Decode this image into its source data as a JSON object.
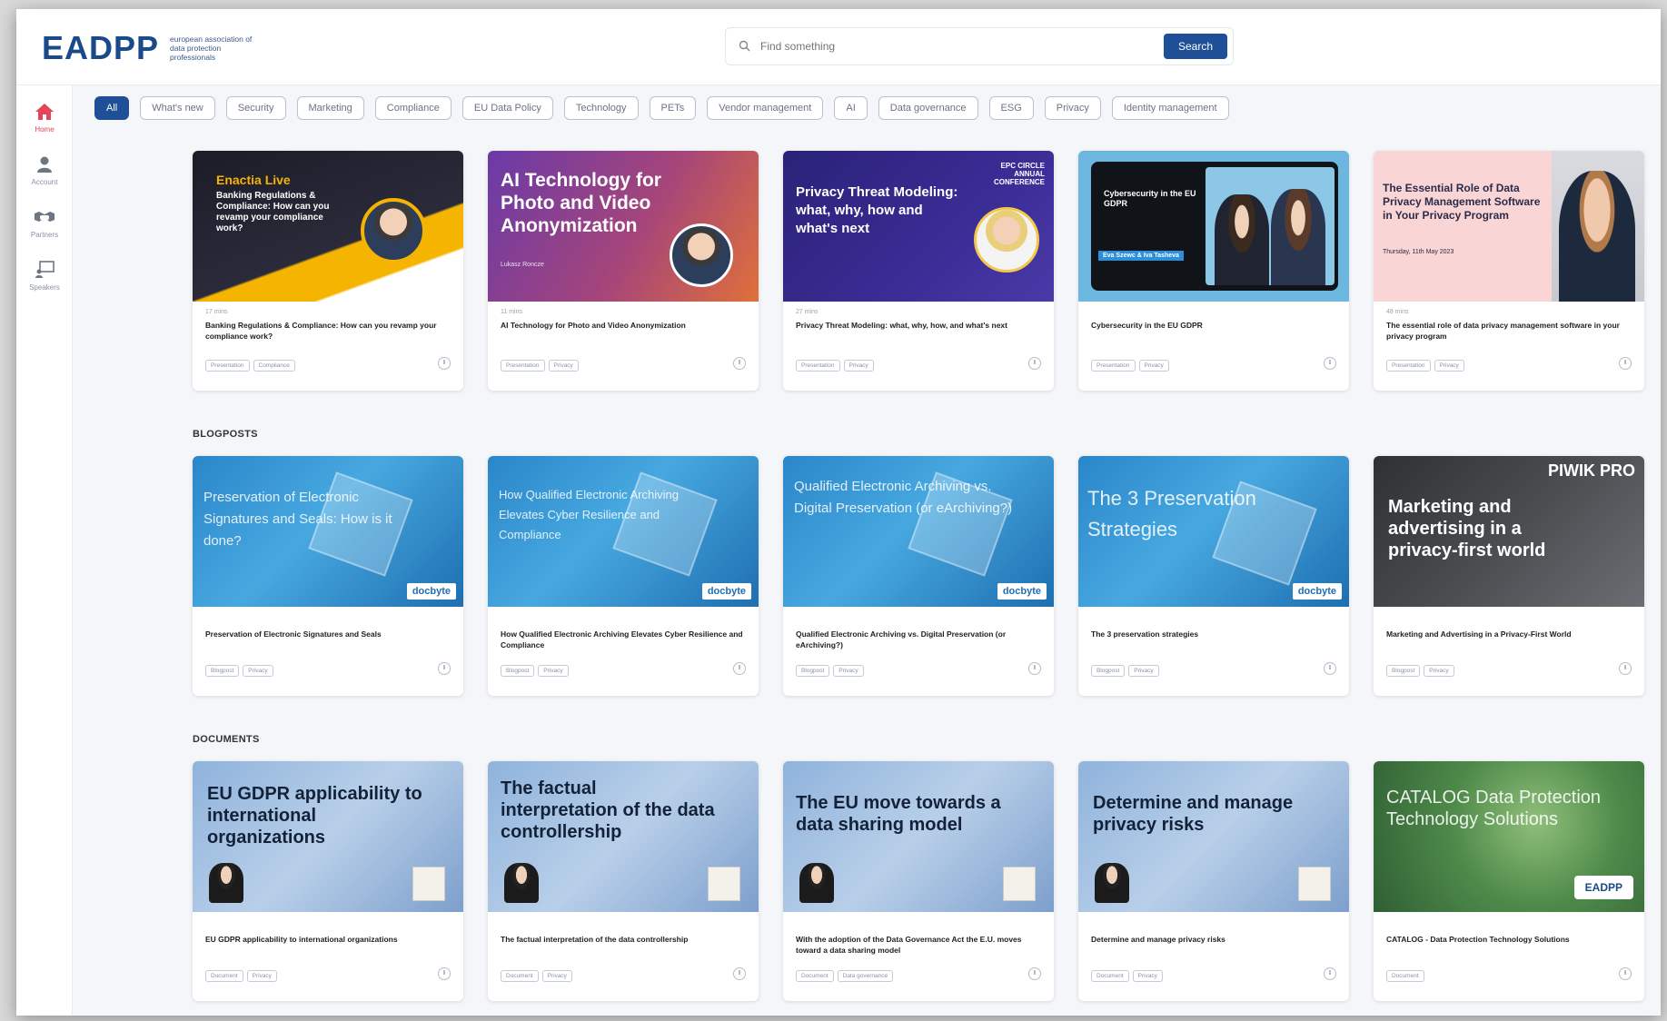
{
  "header": {
    "logo": "EADPP",
    "logo_sub": "european association of data protection professionals",
    "search_placeholder": "Find something",
    "search_button": "Search"
  },
  "sidebar": {
    "items": [
      {
        "label": "Home",
        "icon": "home-icon"
      },
      {
        "label": "Account",
        "icon": "user-icon"
      },
      {
        "label": "Partners",
        "icon": "handshake-icon"
      },
      {
        "label": "Speakers",
        "icon": "presentation-icon"
      }
    ]
  },
  "filters": [
    "All",
    "What's new",
    "Security",
    "Marketing",
    "Compliance",
    "EU Data Policy",
    "Technology",
    "PETs",
    "Vendor management",
    "AI",
    "Data governance",
    "ESG",
    "Privacy",
    "Identity management"
  ],
  "sections": {
    "blogposts": "BLOGPOSTS",
    "documents": "DOCUMENTS"
  },
  "presentations": [
    {
      "thumb_title": "Enactia Live",
      "thumb_sub": "Banking Regulations & Compliance: How can you revamp your compliance work?",
      "meta": "17 mins",
      "title": "Banking Regulations & Compliance: How can you revamp your compliance work?",
      "tags": [
        "Presentation",
        "Compliance"
      ]
    },
    {
      "thumb_title": "AI Technology for Photo and Video Anonymization",
      "thumb_sub": "Lukasz Roncze",
      "meta": "11 mins",
      "title": "AI Technology for Photo and Video Anonymization",
      "tags": [
        "Presentation",
        "Privacy"
      ]
    },
    {
      "thumb_title": "Privacy Threat Modeling: what, why, how and what's next",
      "thumb_sub": "EPC CIRCLE ANNUAL CONFERENCE",
      "meta": "27 mins",
      "title": "Privacy Threat Modeling: what, why, how, and what's next",
      "tags": [
        "Presentation",
        "Privacy"
      ]
    },
    {
      "thumb_title": "Cybersecurity in the EU GDPR",
      "thumb_sub": "Eva Szewc & Iva Tasheva",
      "meta": "",
      "title": "Cybersecurity in the EU GDPR",
      "tags": [
        "Presentation",
        "Privacy"
      ]
    },
    {
      "thumb_title": "The Essential Role of Data Privacy Management Software in Your Privacy Program",
      "thumb_sub": "Thursday, 11th May 2023",
      "meta": "48 mins",
      "title": "The essential role of data privacy management software in your privacy program",
      "tags": [
        "Presentation",
        "Privacy"
      ]
    }
  ],
  "blogposts": [
    {
      "thumb_title": "Preservation of Electronic Signatures and Seals: How is it done?",
      "title": "Preservation of Electronic Signatures and Seals",
      "tags": [
        "Blogpost",
        "Privacy"
      ],
      "brand": "docbyte"
    },
    {
      "thumb_title": "How Qualified Electronic Archiving Elevates Cyber Resilience and Compliance",
      "title": "How Qualified Electronic Archiving Elevates Cyber Resilience and Compliance",
      "tags": [
        "Blogpost",
        "Privacy"
      ],
      "brand": "docbyte"
    },
    {
      "thumb_title": "Qualified Electronic Archiving vs. Digital Preservation (or eArchiving?)",
      "title": "Qualified Electronic Archiving vs. Digital Preservation (or eArchiving?)",
      "tags": [
        "Blogpost",
        "Privacy"
      ],
      "brand": "docbyte"
    },
    {
      "thumb_title": "The 3 Preservation Strategies",
      "title": "The 3 preservation strategies",
      "tags": [
        "Blogpost",
        "Privacy"
      ],
      "brand": "docbyte"
    },
    {
      "thumb_title": "Marketing and advertising in a privacy-first world",
      "title": "Marketing and Advertising in a Privacy-First World",
      "tags": [
        "Blogpost",
        "Privacy"
      ],
      "brand": "PIWIK PRO"
    }
  ],
  "documents": [
    {
      "thumb_title": "EU GDPR applicability to international organizations",
      "title": "EU GDPR applicability to international organizations",
      "tags": [
        "Document",
        "Privacy"
      ]
    },
    {
      "thumb_title": "The factual interpretation of the data controllership",
      "title": "The factual interpretation of the data controllership",
      "tags": [
        "Document",
        "Privacy"
      ]
    },
    {
      "thumb_title": "The EU move towards a data sharing model",
      "title": "With the adoption of the Data Governance Act the E.U. moves toward a data sharing model",
      "tags": [
        "Document",
        "Data governance"
      ]
    },
    {
      "thumb_title": "Determine and manage privacy risks",
      "title": "Determine and manage privacy risks",
      "tags": [
        "Document",
        "Privacy"
      ]
    },
    {
      "thumb_title": "CATALOG Data Protection Technology Solutions",
      "title": "CATALOG - Data Protection Technology Solutions",
      "tags": [
        "Document"
      ],
      "brand": "EADPP"
    }
  ],
  "colors": {
    "accent": "#1f4f97",
    "home_active": "#e3455a"
  }
}
